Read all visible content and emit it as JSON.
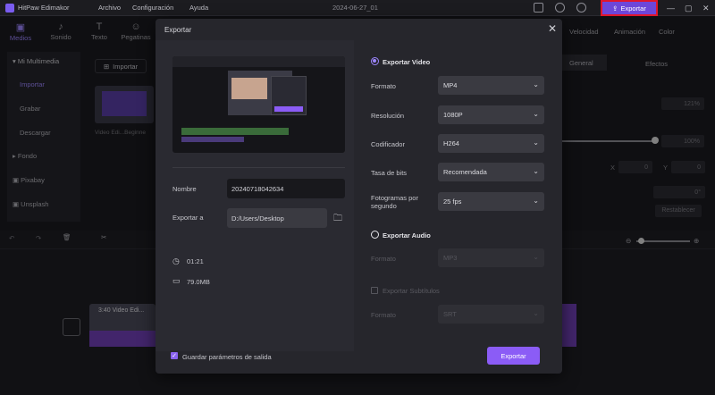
{
  "app": {
    "name": "HitPaw Edimakor",
    "menu": [
      "Archivo",
      "Configuración",
      "Ayuda"
    ],
    "date_title": "2024-06-27_01",
    "export_label": "Exportar"
  },
  "toolbar": {
    "tools": [
      {
        "label": "Medios",
        "icon": "media-icon"
      },
      {
        "label": "Sonido",
        "icon": "music-icon"
      },
      {
        "label": "Texto",
        "icon": "text-icon"
      },
      {
        "label": "Pegatinas",
        "icon": "sticker-icon"
      }
    ]
  },
  "sidebar": {
    "header": "Mi Multimedia",
    "items": [
      "Importar",
      "Grabar",
      "Descargar"
    ],
    "groups": [
      "Fondo",
      "Pixabay",
      "Unsplash"
    ]
  },
  "media": {
    "import_label": "Importar",
    "clip_label": "Video Edi...Beginne"
  },
  "right_panel": {
    "tabs": [
      "Velocidad",
      "Animación",
      "Color"
    ],
    "sub_tabs": [
      "General",
      "Efectos"
    ],
    "scale_value": "121%",
    "opacity_value": "100%",
    "x_label": "X",
    "x_value": "0",
    "y_label": "Y",
    "y_value": "0",
    "rotation": "0°",
    "reset_label": "Restablecer"
  },
  "timeline": {
    "clip_label": "3:40 Video Edi..."
  },
  "dialog": {
    "title": "Exportar",
    "name_label": "Nombre",
    "name_value": "20240718042634",
    "export_to_label": "Exportar a",
    "export_to_value": "D:/Users/Desktop",
    "duration": "01:21",
    "size": "79.0MB",
    "save_params_label": "Guardar parámetros de salida",
    "export_button": "Exportar",
    "video": {
      "section": "Exportar Video",
      "format_label": "Formato",
      "format_value": "MP4",
      "resolution_label": "Resolución",
      "resolution_value": "1080P",
      "codec_label": "Codificador",
      "codec_value": "H264",
      "bitrate_label": "Tasa de bits",
      "bitrate_value": "Recomendada",
      "fps_label": "Fotogramas por segundo",
      "fps_value": "25  fps"
    },
    "audio": {
      "section": "Exportar Audio",
      "format_label": "Formato",
      "format_value": "MP3"
    },
    "subtitles": {
      "section": "Exportar Subtítulos",
      "format_label": "Formato",
      "format_value": "SRT"
    }
  },
  "colors": {
    "accent": "#8b5cf6",
    "highlight_border": "#e0162b"
  }
}
